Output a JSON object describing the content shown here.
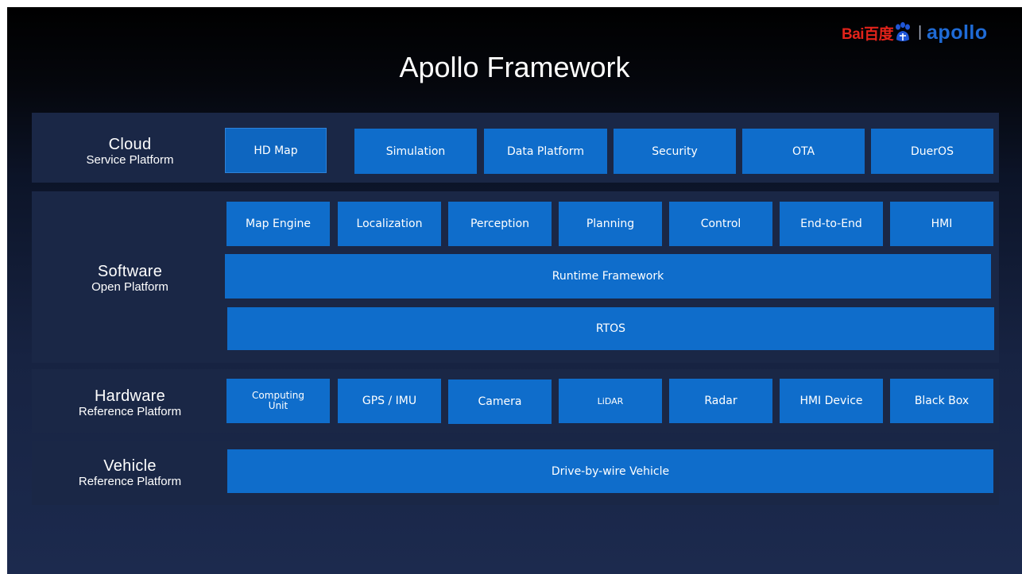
{
  "title": "Apollo Framework",
  "logo": {
    "baidu_text": "Bai百度",
    "separator": "|",
    "apollo_text": "apollo",
    "paw_icon": "baidu-paw-icon"
  },
  "colors": {
    "block_fill": "#0f6dcb",
    "band_fill": "#1a2746",
    "background_top": "#000000",
    "background_bottom": "#1c2a4e",
    "baidu_red": "#e2231a",
    "apollo_blue": "#1f6bd6"
  },
  "layers": {
    "cloud": {
      "title": "Cloud",
      "subtitle": "Service Platform",
      "blocks": [
        "HD Map",
        "Simulation",
        "Data Platform",
        "Security",
        "OTA",
        "DuerOS"
      ]
    },
    "software": {
      "title": "Software",
      "subtitle": "Open Platform",
      "modules": [
        "Map Engine",
        "Localization",
        "Perception",
        "Planning",
        "Control",
        "End-to-End",
        "HMI"
      ],
      "runtime": "Runtime Framework",
      "rtos": "RTOS"
    },
    "hardware": {
      "title": "Hardware",
      "subtitle": "Reference Platform",
      "blocks": [
        "Computing\nUnit",
        "GPS / IMU",
        "Camera",
        "LiDAR",
        "Radar",
        "HMI Device",
        "Black Box"
      ]
    },
    "vehicle": {
      "title": "Vehicle",
      "subtitle": "Reference Platform",
      "block": "Drive-by-wire Vehicle"
    }
  }
}
